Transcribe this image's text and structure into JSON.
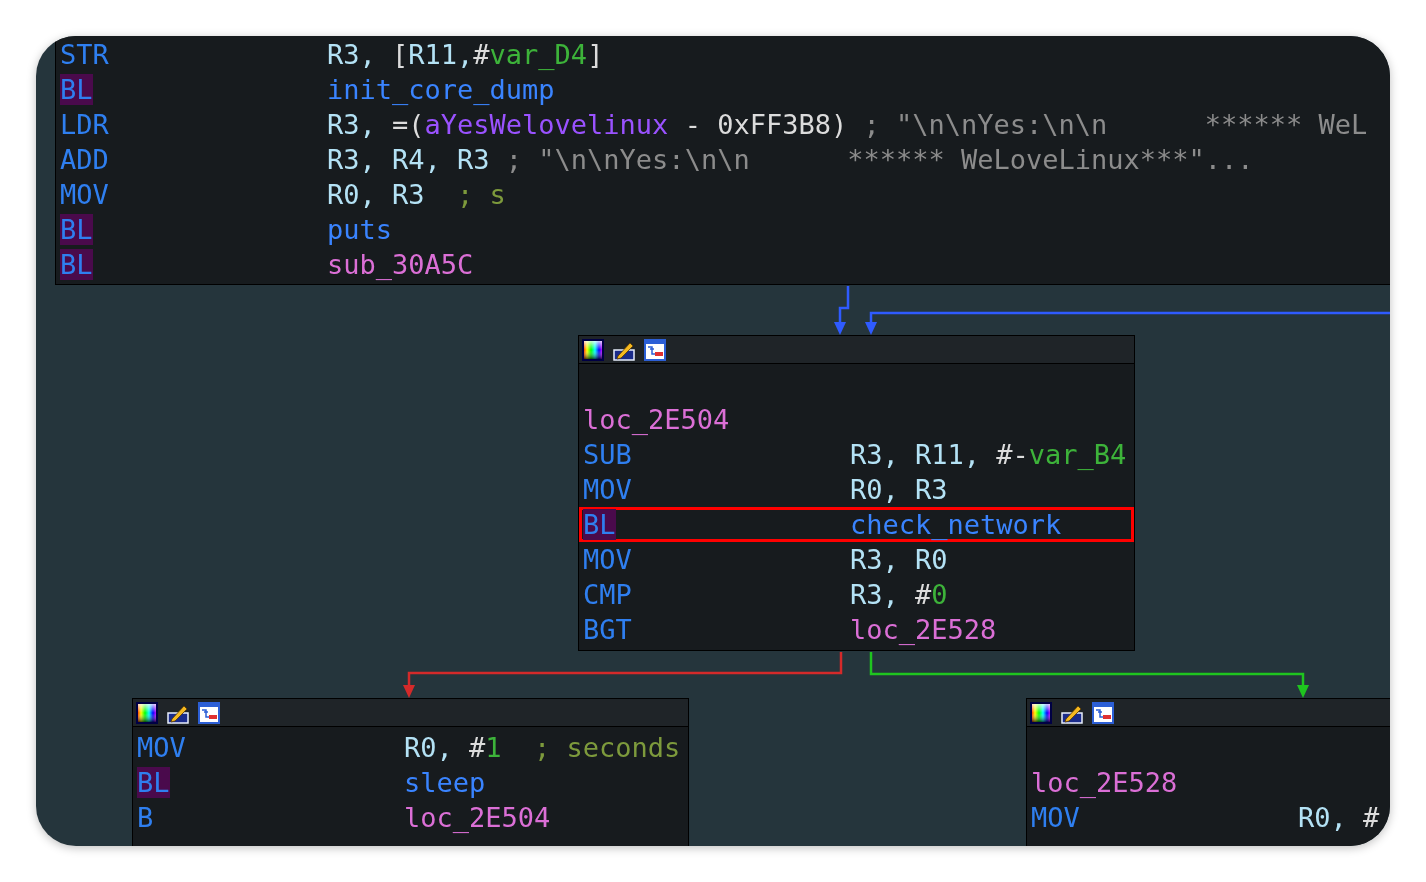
{
  "nodes": [
    {
      "header": false,
      "lines": [
        {
          "kind": "instr",
          "mnemonic": "STR",
          "highlight": false,
          "selected": false,
          "operands": [
            {
              "kind": "reg",
              "text": "R3, "
            },
            {
              "kind": "punct",
              "text": "["
            },
            {
              "kind": "reg",
              "text": "R11,"
            },
            {
              "kind": "punct",
              "text": "#"
            },
            {
              "kind": "var",
              "text": "var_D4"
            },
            {
              "kind": "punct",
              "text": "]"
            }
          ]
        },
        {
          "kind": "instr",
          "mnemonic": "BL",
          "highlight": true,
          "selected": false,
          "operands": [
            {
              "kind": "func",
              "text": "init_core_dump"
            }
          ]
        },
        {
          "kind": "instr",
          "mnemonic": "LDR",
          "highlight": false,
          "selected": false,
          "operands": [
            {
              "kind": "reg",
              "text": "R3, "
            },
            {
              "kind": "punct",
              "text": "=("
            },
            {
              "kind": "string",
              "text": "aYesWelovelinux"
            },
            {
              "kind": "punct",
              "text": " - 0xFF3B8)"
            },
            {
              "kind": "comment",
              "text": " ; \"\\n\\nYes:\\n\\n      ****** WeL"
            }
          ]
        },
        {
          "kind": "instr",
          "mnemonic": "ADD",
          "highlight": false,
          "selected": false,
          "operands": [
            {
              "kind": "reg",
              "text": "R3, R4, R3"
            },
            {
              "kind": "comment",
              "text": " ; \"\\n\\nYes:\\n\\n      ****** WeLoveLinux***\"..."
            }
          ]
        },
        {
          "kind": "instr",
          "mnemonic": "MOV",
          "highlight": false,
          "selected": false,
          "operands": [
            {
              "kind": "reg",
              "text": "R0, R3"
            },
            {
              "kind": "autocomment",
              "text": "  ; s"
            }
          ]
        },
        {
          "kind": "instr",
          "mnemonic": "BL",
          "highlight": true,
          "selected": false,
          "operands": [
            {
              "kind": "func",
              "text": "puts"
            }
          ]
        },
        {
          "kind": "instr",
          "mnemonic": "BL",
          "highlight": true,
          "selected": false,
          "operands": [
            {
              "kind": "label",
              "text": "sub_30A5C"
            }
          ]
        }
      ]
    },
    {
      "header": true,
      "lines": [
        {
          "kind": "blank"
        },
        {
          "kind": "label",
          "text": "loc_2E504"
        },
        {
          "kind": "instr",
          "mnemonic": "SUB",
          "highlight": false,
          "selected": false,
          "operands": [
            {
              "kind": "reg",
              "text": "R3, R11, "
            },
            {
              "kind": "punct",
              "text": "#-"
            },
            {
              "kind": "var",
              "text": "var_B4"
            }
          ]
        },
        {
          "kind": "instr",
          "mnemonic": "MOV",
          "highlight": false,
          "selected": false,
          "operands": [
            {
              "kind": "reg",
              "text": "R0, R3"
            }
          ]
        },
        {
          "kind": "instr",
          "mnemonic": "BL",
          "highlight": true,
          "selected": true,
          "operands": [
            {
              "kind": "func",
              "text": "check_network"
            }
          ]
        },
        {
          "kind": "instr",
          "mnemonic": "MOV",
          "highlight": false,
          "selected": false,
          "operands": [
            {
              "kind": "reg",
              "text": "R3, R0"
            }
          ]
        },
        {
          "kind": "instr",
          "mnemonic": "CMP",
          "highlight": false,
          "selected": false,
          "operands": [
            {
              "kind": "reg",
              "text": "R3, "
            },
            {
              "kind": "punct",
              "text": "#"
            },
            {
              "kind": "num",
              "text": "0"
            }
          ]
        },
        {
          "kind": "instr",
          "mnemonic": "BGT",
          "highlight": false,
          "selected": false,
          "operands": [
            {
              "kind": "label",
              "text": "loc_2E528"
            }
          ]
        }
      ]
    },
    {
      "header": true,
      "lines": [
        {
          "kind": "instr",
          "mnemonic": "MOV",
          "highlight": false,
          "selected": false,
          "operands": [
            {
              "kind": "reg",
              "text": "R0, "
            },
            {
              "kind": "punct",
              "text": "#"
            },
            {
              "kind": "num",
              "text": "1"
            },
            {
              "kind": "autocomment",
              "text": "  ; seconds"
            }
          ]
        },
        {
          "kind": "instr",
          "mnemonic": "BL",
          "highlight": true,
          "selected": false,
          "operands": [
            {
              "kind": "func",
              "text": "sleep"
            }
          ]
        },
        {
          "kind": "instr",
          "mnemonic": "B",
          "highlight": false,
          "selected": false,
          "operands": [
            {
              "kind": "label",
              "text": "loc_2E504"
            }
          ]
        }
      ]
    },
    {
      "header": true,
      "lines": [
        {
          "kind": "blank"
        },
        {
          "kind": "label",
          "text": "loc_2E528"
        },
        {
          "kind": "instr",
          "mnemonic": "MOV",
          "highlight": false,
          "selected": false,
          "operands": [
            {
              "kind": "reg",
              "text": "R0, "
            },
            {
              "kind": "punct",
              "text": "#"
            }
          ]
        }
      ]
    }
  ],
  "edges": [
    {
      "color": "#2f5bff"
    },
    {
      "color": "#2f5bff"
    },
    {
      "color": "#d42a2a"
    },
    {
      "color": "#1fc41f"
    }
  ]
}
